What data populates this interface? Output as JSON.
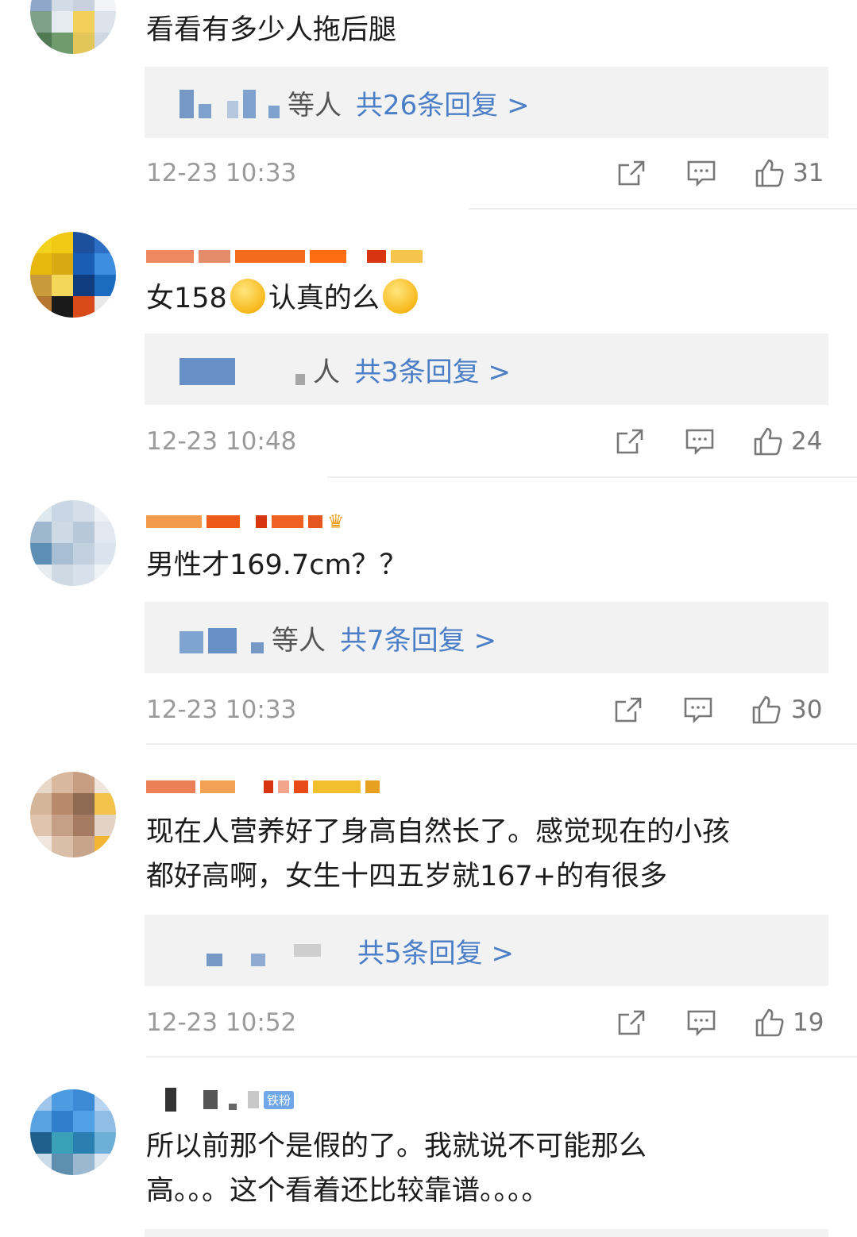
{
  "comments": [
    {
      "text": "看看有多少人拖后腿",
      "reply_who": "等人",
      "reply_count": "共26条回复 >",
      "time": "12-23 10:33",
      "likes": "31"
    },
    {
      "text_before": "女158",
      "text_after": "认真的么",
      "reply_who": "人",
      "reply_count": "共3条回复 >",
      "time": "12-23 10:48",
      "likes": "24"
    },
    {
      "text": "男性才169.7cm？？",
      "reply_who": "等人",
      "reply_count": "共7条回复 >",
      "time": "12-23 10:33",
      "likes": "30"
    },
    {
      "text": "现在人营养好了身高自然长了。感觉现在的小孩\n都好高啊，女生十四五岁就167+的有很多",
      "reply_count": "共5条回复 >",
      "time": "12-23 10:52",
      "likes": "19"
    },
    {
      "badge": "铁粉",
      "text": "所以前那个是假的了。我就说不可能那么\n高。。。这个看着还比较靠谱。。。。"
    }
  ],
  "icons": {
    "share": "share-icon",
    "comment": "comment-icon",
    "like": "thumbs-up-icon"
  },
  "colors": {
    "link_blue": "#4a7ec6",
    "time_gray": "#9a9a9a",
    "reply_bg": "#f2f2f2"
  }
}
